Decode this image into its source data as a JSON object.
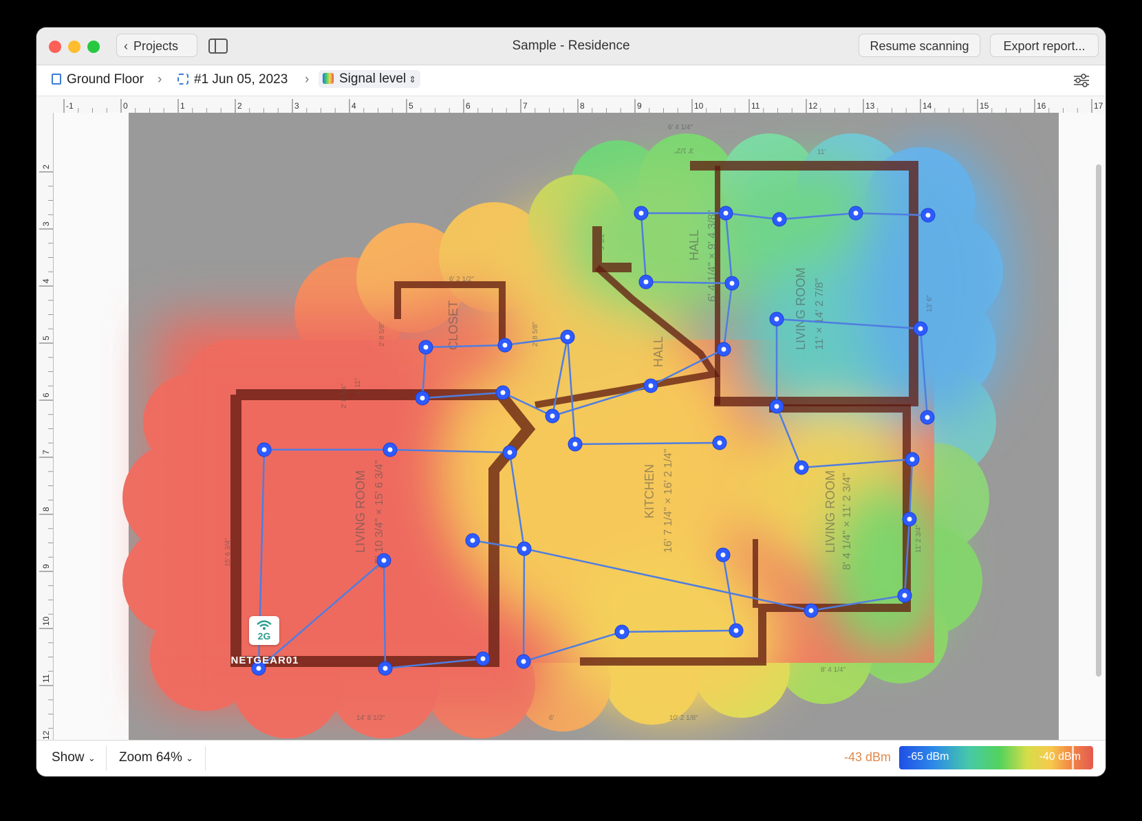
{
  "window": {
    "title": "Sample - Residence",
    "back_label": "Projects",
    "resume_label": "Resume scanning",
    "export_label": "Export report..."
  },
  "breadcrumb": {
    "floor": "Ground Floor",
    "scan": "#1 Jun 05, 2023",
    "view": "Signal level"
  },
  "ruler": {
    "h_ticks": [
      "-1",
      "0",
      "1",
      "2",
      "3",
      "4",
      "5",
      "6",
      "7",
      "8",
      "9",
      "10",
      "11",
      "12",
      "13",
      "14",
      "15",
      "16",
      "17"
    ],
    "v_ticks": [
      "2",
      "3",
      "4",
      "5",
      "6",
      "7",
      "8",
      "9",
      "10",
      "11",
      "12"
    ]
  },
  "plan": {
    "rooms": [
      {
        "name": "LIVING ROOM",
        "dims": "15' 10 3/4\" × 15' 6 3/4\""
      },
      {
        "name": "CLOSET",
        "dims": ""
      },
      {
        "name": "KITCHEN",
        "dims": "16' 7 1/4\" × 16' 2 1/4\""
      },
      {
        "name": "HALL",
        "dims": "6' 4 1/4\" × 9' 4 3/8\""
      },
      {
        "name": "HALL",
        "dims": ""
      },
      {
        "name": "LIVING ROOM",
        "dims": "11' × 14' 2 7/8\""
      },
      {
        "name": "LIVING ROOM",
        "dims": "8' 4 1/4\" × 11' 2 3/4\""
      }
    ],
    "measurements": [
      "6' 4 1/4\"",
      "3' 1/2\"",
      "11'",
      "5' 1/2\"",
      "6' 2 1/2\"",
      "2' 8 5/8\"",
      "2' 8 5/8\"",
      "1' 11\"",
      "2' 8 3/4\"",
      "15' 6 3/4\"",
      "14' 8 1/2\"",
      "6'",
      "10' 2 1/8\"",
      "8' 4 1/4\"",
      "11' 2 3/4\"",
      "13' 6\""
    ]
  },
  "access_point": {
    "name": "NETGEAR01",
    "band": "2G"
  },
  "bottom": {
    "show_label": "Show",
    "zoom_label": "Zoom 64%",
    "current_dbm": "-43 dBm",
    "legend_min": "-65 dBm",
    "legend_max": "-40 dBm"
  },
  "colors": {
    "accent": "#2e5bff",
    "path_line": "#4f7de0",
    "strong": "#ee6a5e",
    "medium": "#f6cc5c",
    "weak": "#5bd18a",
    "weakest": "#5aa9e8"
  }
}
